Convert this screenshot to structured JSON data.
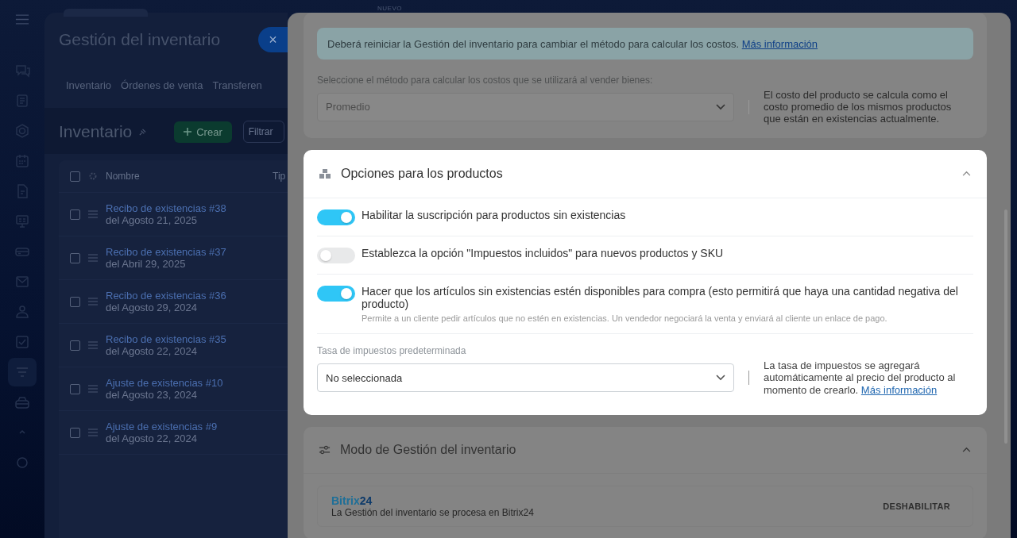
{
  "background_app": {
    "new_label": "NUEVO",
    "title": "Gestión del inventario",
    "close_button": "×",
    "tabs": [
      "Inventario",
      "Órdenes de venta",
      "Transferen"
    ],
    "select_all_checked": false,
    "page_title": "Inventario",
    "create_button": "Crear",
    "filter_placeholder": "Filtrar",
    "table": {
      "columns": [
        "Nombre",
        "Tip"
      ],
      "rows": [
        {
          "title": "Recibo de existencias #38",
          "date": "del Agosto 21, 2025",
          "checked": false
        },
        {
          "title": "Recibo de existencias #37",
          "date": "del Abril 29, 2025",
          "checked": false
        },
        {
          "title": "Recibo de existencias #36",
          "date": "del Agosto 29, 2024",
          "checked": false
        },
        {
          "title": "Recibo de existencias #35",
          "date": "del Agosto 22, 2024",
          "checked": false
        },
        {
          "title": "Ajuste de existencias #10",
          "date": "del Agosto 23, 2024",
          "checked": false
        },
        {
          "title": "Ajuste de existencias #9",
          "date": "del Agosto 22, 2024",
          "checked": false
        }
      ]
    }
  },
  "settings_panel": {
    "notice": {
      "text": "Deberá reiniciar la Gestión del inventario para cambiar el método para calcular los costos.",
      "link": "Más información"
    },
    "cost_method": {
      "label": "Seleccione el método para calcular los costos que se utilizará al vender bienes:",
      "value": "Promedio",
      "description": "El costo del producto se calcula como el costo promedio de los mismos productos que están en existencias actualmente."
    },
    "product_options": {
      "title": "Opciones para los productos",
      "options": [
        {
          "label": "Habilitar la suscripción para productos sin existencias",
          "on": true
        },
        {
          "label": "Establezca la opción \"Impuestos incluidos\" para nuevos productos y SKU",
          "on": false
        },
        {
          "label": "Hacer que los artículos sin existencias estén disponibles para compra (esto permitirá que haya una cantidad negativa del producto)",
          "hint": "Permite a un cliente pedir artículos que no estén en existencias. Un vendedor negociará la venta y enviará al cliente un enlace de pago.",
          "on": true
        }
      ],
      "tax_rate": {
        "label": "Tasa de impuestos predeterminada",
        "value": "No seleccionada",
        "description": "La tasa de impuestos se agregará automáticamente al precio del producto al momento de crearlo.",
        "link": "Más información"
      }
    },
    "inventory_mode": {
      "title": "Modo de Gestión del inventario",
      "provider_logo": [
        "Bitrix",
        "24"
      ],
      "provider_description": "La Gestión del inventario se procesa en Bitrix24",
      "button": "DESHABILITAR"
    }
  }
}
